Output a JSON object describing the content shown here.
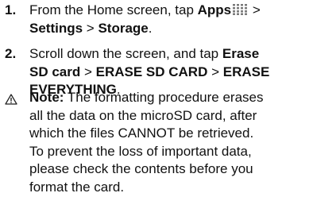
{
  "steps": [
    {
      "number": "1.",
      "line1_pre": "From the Home screen, tap ",
      "apps_label": "Apps",
      "apps_icon": "apps-grid-icon",
      "line1_post": " >",
      "settings_label": "Settings",
      "separator": " > ",
      "storage_label": "Storage",
      "end_period": "."
    },
    {
      "number": "2.",
      "line1_pre": "Scroll down the screen, and tap ",
      "erase_sd_word": "Erase",
      "sd_card_label": "SD card",
      "separator1": " > ",
      "erase_sd_button": "ERASE SD CARD",
      "separator2": " > ",
      "erase_label": "ERASE",
      "everything_label": "EVERYTHING",
      "end_period": "."
    }
  ],
  "note": {
    "icon": "warning-icon",
    "label": "Note:",
    "lines": [
      " The formatting procedure erases",
      "all the data on the microSD card, after",
      "which the files CANNOT be retrieved.",
      "To prevent the loss of important data,",
      "please check the contents before you",
      "format the card."
    ]
  }
}
